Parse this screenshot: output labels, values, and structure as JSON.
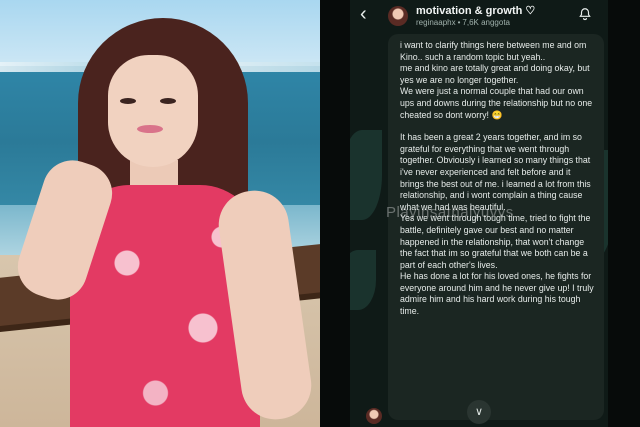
{
  "channel": {
    "title": "motivation & growth ♡",
    "handle": "reginaaphx",
    "members": "7,6K anggota"
  },
  "icons": {
    "back": "back-arrow-icon",
    "bell": "bell-icon",
    "scroll": "chevron-down-icon"
  },
  "message": {
    "paragraphs": [
      "i want to clarify things here between me and om Kino.. such a random topic but yeah..",
      "me and kino are totally great and doing okay, but yes we are no longer together.",
      "We were just a normal couple that had our own ups and downs during the relationship but no one cheated so dont worry! 😁",
      "It has been a great 2 years together, and im so grateful for everything that we went through together. Obviously i learned so many things that i've never experienced and felt before and it brings the best out of me. i learned a lot from this relationship, and i wont complain a thing cause what we had was beautiful.",
      "Yes we went through tough time, tried to fight the battle, definitely gave our best and no matter happened in the relationship, that won't change the fact that im so grateful that we both can be a part of each other's lives.",
      "He has done a lot for his loved ones, he fights for everyone around him and he never give up! I truly admire him and his hard work during his tough time."
    ]
  },
  "watermark": "Playinsatnalyuvvs",
  "colors": {
    "bubble": "#1b2622",
    "background": "#0f1a17",
    "text": "#e6ebe9"
  }
}
